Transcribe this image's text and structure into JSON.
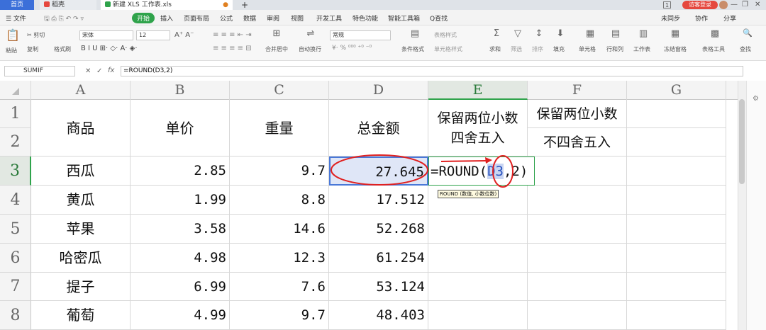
{
  "tabs": {
    "home": "首页",
    "daoke": "稻壳",
    "file": "新建 XLS 工作表.xls",
    "add": "+"
  },
  "window": {
    "login": "访客登录",
    "min": "—",
    "restore": "❐",
    "close": "✕",
    "badge": "1"
  },
  "menu": {
    "file": "☰ 文件",
    "start": "开始",
    "items": [
      "插入",
      "页面布局",
      "公式",
      "数据",
      "审阅",
      "视图",
      "开发工具",
      "特色功能",
      "智能工具箱"
    ],
    "search": "Q查找",
    "right": [
      "未同步",
      "协作",
      "分享"
    ]
  },
  "ribbon": {
    "cut": "✂ 剪切",
    "paste": "粘贴",
    "copy": "复制",
    "format_painter": "格式刷",
    "font_name": "宋体",
    "font_size": "12",
    "number_format": "常规",
    "wrap": "自动换行",
    "merge": "合并居中",
    "table_style": "表格样式",
    "cond_format": "条件格式",
    "cell_style": "单元格样式",
    "sum": "求和",
    "filter": "筛选",
    "sort": "排序",
    "fill": "填充",
    "cell": "单元格",
    "rowcol": "行和列",
    "sheet": "工作表",
    "freeze": "冻结窗格",
    "tools": "表格工具",
    "find": "查找",
    "icons": {
      "sum": "Σ",
      "filter": "▽",
      "sort": "↕",
      "fill": "⬇",
      "cell": "▦",
      "rowcol": "▤",
      "sheet": "▥",
      "freeze": "▦",
      "tools": "▩",
      "find": "🔍",
      "wrap": "⇌",
      "merge": "⊞",
      "cond": "▤"
    }
  },
  "formula_bar": {
    "namebox": "SUMIF",
    "cancel": "✕",
    "confirm": "✓",
    "fx": "fx",
    "formula": "=ROUND(D3,2)"
  },
  "columns": [
    "A",
    "B",
    "C",
    "D",
    "E",
    "F",
    "G"
  ],
  "rows": [
    "1",
    "2",
    "3",
    "4",
    "5",
    "6",
    "7",
    "8"
  ],
  "header": {
    "product": "商品",
    "price": "单价",
    "weight": "重量",
    "total": "总金额",
    "e_line1": "保留两位小数",
    "e_line2": "四舍五入",
    "f_line1": "保留两位小数",
    "f_line2": "不四舍五入"
  },
  "data": [
    {
      "product": "西瓜",
      "price": "2.85",
      "weight": "9.7",
      "total": "27.645"
    },
    {
      "product": "黄瓜",
      "price": "1.99",
      "weight": "8.8",
      "total": "17.512"
    },
    {
      "product": "苹果",
      "price": "3.58",
      "weight": "14.6",
      "total": "52.268"
    },
    {
      "product": "哈密瓜",
      "price": "4.98",
      "weight": "12.3",
      "total": "61.254"
    },
    {
      "product": "提子",
      "price": "6.99",
      "weight": "7.6",
      "total": "53.124"
    },
    {
      "product": "葡萄",
      "price": "4.99",
      "weight": "9.7",
      "total": "48.403"
    }
  ],
  "editing": {
    "prefix": "=ROUND(",
    "ref": "D3",
    "suffix": ",2)",
    "tooltip": "ROUND (数值, 小数位数)"
  },
  "colors": {
    "accent": "#2fa34b",
    "selection": "#dfe6f7",
    "ref_border": "#4a78d8",
    "annotation": "#e02020",
    "tab_blue": "#3b6fd9"
  }
}
